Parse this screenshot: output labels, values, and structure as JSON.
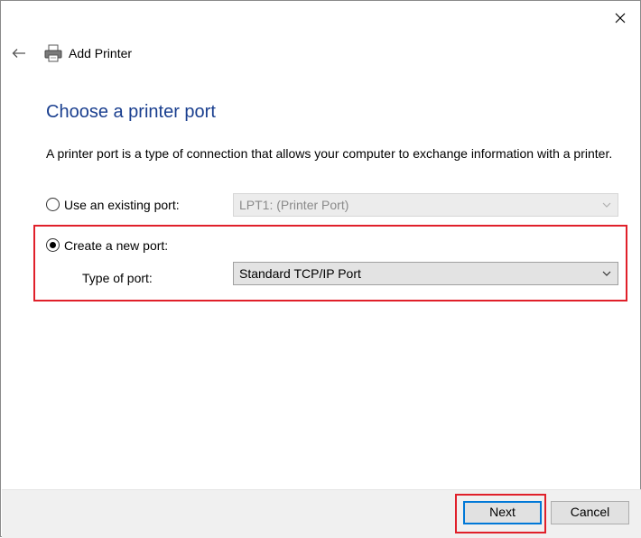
{
  "window": {
    "title": "Add Printer",
    "close_icon": "close-icon",
    "back_icon": "back-arrow-icon",
    "app_icon": "printer-icon"
  },
  "page": {
    "heading": "Choose a printer port",
    "description": "A printer port is a type of connection that allows your computer to exchange information with a printer."
  },
  "options": {
    "existing": {
      "label": "Use an existing port:",
      "selected": false,
      "value": "LPT1: (Printer Port)",
      "enabled": false
    },
    "new": {
      "label": "Create a new port:",
      "selected": true,
      "type_label": "Type of port:",
      "value": "Standard TCP/IP Port",
      "enabled": true
    }
  },
  "footer": {
    "next_label": "Next",
    "cancel_label": "Cancel"
  },
  "colors": {
    "heading": "#1a3f8f",
    "highlight": "#e0202a",
    "default_button_border": "#0078d7"
  }
}
